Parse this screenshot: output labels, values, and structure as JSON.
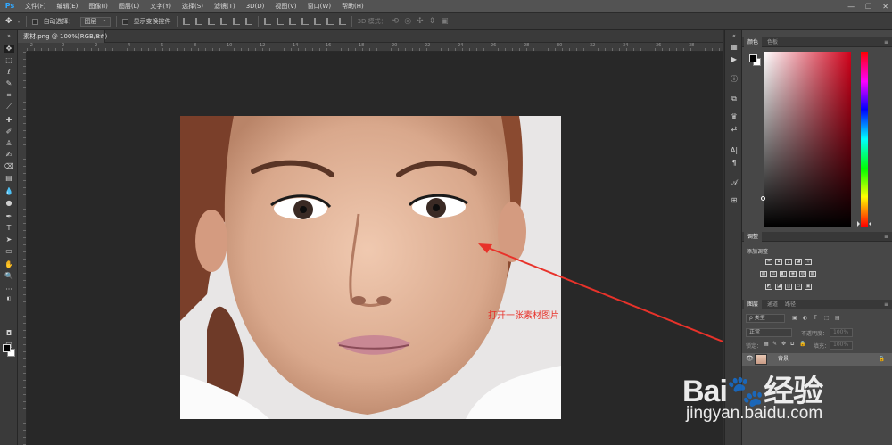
{
  "app": {
    "logo": "Ps"
  },
  "menubar": {
    "items": [
      "文件(F)",
      "编辑(E)",
      "图像(I)",
      "图层(L)",
      "文字(Y)",
      "选择(S)",
      "滤镜(T)",
      "3D(D)",
      "视图(V)",
      "窗口(W)",
      "帮助(H)"
    ],
    "window_controls": {
      "minimize": "—",
      "restore": "❐",
      "close": "✕"
    }
  },
  "options": {
    "auto_select_label": "自动选择：",
    "auto_select_value": "图层",
    "show_transform_label": "显示变换控件",
    "mode_3d_label": "3D 模式："
  },
  "document": {
    "tab_title": "素材.png @ 100%(RGB/8#)",
    "tab_close": "×"
  },
  "ruler": {
    "h_labels": [
      "-2",
      "0",
      "2",
      "4",
      "6",
      "8",
      "10",
      "12",
      "14",
      "16",
      "18",
      "20",
      "22",
      "24",
      "26",
      "28",
      "30",
      "32",
      "34",
      "36",
      "38"
    ]
  },
  "annotation": {
    "text": "打开一张素材图片",
    "color": "#e8322a"
  },
  "panels": {
    "color_tabs": [
      "颜色",
      "色板"
    ],
    "adjustments_tab": "调整",
    "adjustments_add_label": "添加调整",
    "layers_tabs": [
      "图层",
      "通道",
      "路径"
    ],
    "layer_kind": "ρ 类型",
    "blend_mode": "正常",
    "opacity_label": "不透明度：",
    "opacity_value": "100%",
    "lock_label": "锁定：",
    "fill_label": "填充：",
    "fill_value": "100%",
    "layer_name": "背景",
    "menu_icon": "≡"
  },
  "colors": {
    "foreground": "#000000",
    "background": "#ffffff",
    "accent_brand": "#31a8ff"
  },
  "watermark": {
    "logo": "Bai🐾经验",
    "url": "jingyan.baidu.com"
  }
}
